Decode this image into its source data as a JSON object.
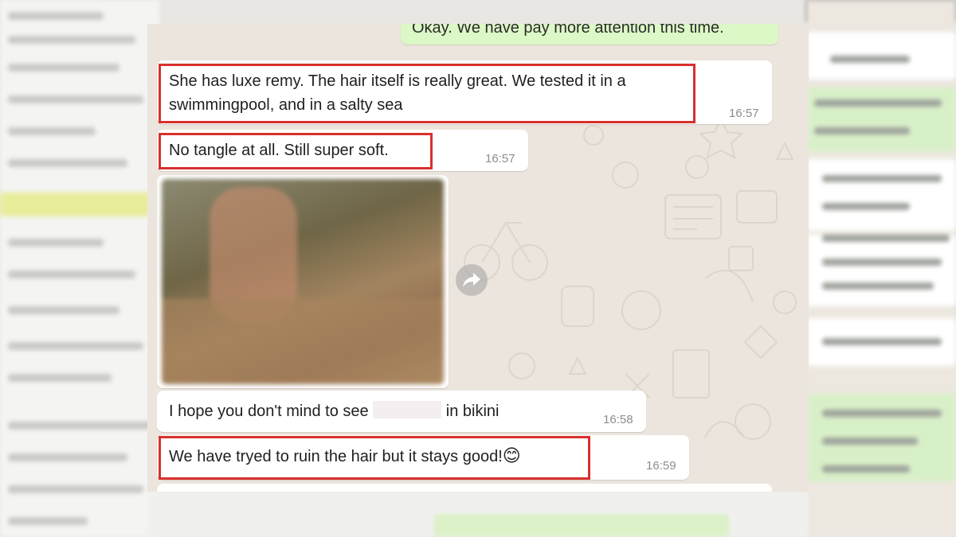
{
  "messages": [
    {
      "id": "m0",
      "dir": "out",
      "text": "Okay. We have pay more attention this time.",
      "time": ""
    },
    {
      "id": "m1",
      "dir": "in",
      "line1": "She has luxe remy. The hair itself is really great. We tested it in a",
      "line2": "swimmingpool, and in a salty sea",
      "time": "16:57"
    },
    {
      "id": "m2",
      "dir": "in",
      "text": "No tangle at all. Still super soft.",
      "time": "16:57"
    },
    {
      "id": "m3",
      "dir": "in",
      "type": "image"
    },
    {
      "id": "m4",
      "dir": "in",
      "text_before": "I hope you don't  mind to see",
      "text_after": "in bikini",
      "time": "16:58"
    },
    {
      "id": "m5",
      "dir": "in",
      "text": "We have tryed to ruin the hair but it stays good!",
      "emoji": "😊",
      "time": "16:59"
    }
  ],
  "colors": {
    "highlight": "#d8302c",
    "incoming_bubble": "#ffffff",
    "outgoing_bubble": "#dcf8c6",
    "chat_background": "#ece5dd"
  },
  "icons": {
    "forward": "forward-arrow-icon"
  }
}
